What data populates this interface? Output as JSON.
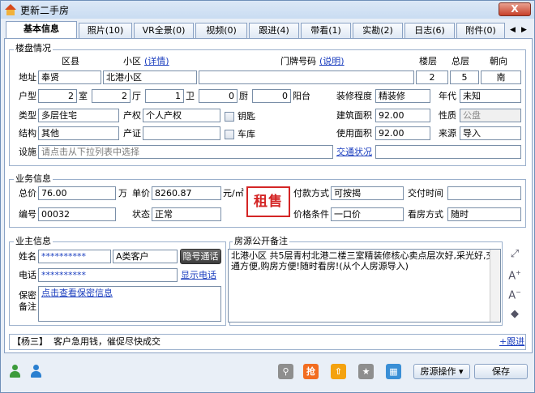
{
  "window": {
    "title": "更新二手房",
    "close_glyph": "X"
  },
  "tabs": [
    {
      "label": "基本信息"
    },
    {
      "label": "照片(10)"
    },
    {
      "label": "VR全景(0)"
    },
    {
      "label": "视频(0)"
    },
    {
      "label": "跟进(4)"
    },
    {
      "label": "带看(1)"
    },
    {
      "label": "实勘(2)"
    },
    {
      "label": "日志(6)"
    },
    {
      "label": "附件(0)"
    }
  ],
  "tab_nav": {
    "prev": "◀",
    "next": "▶"
  },
  "property": {
    "section_title": "楼盘情况",
    "hdr_district": "区县",
    "hdr_community": "小区",
    "hdr_community_link": "(详情)",
    "hdr_door": "门牌号码",
    "hdr_door_link": "(说明)",
    "hdr_floor": "楼层",
    "hdr_total_floor": "总层",
    "hdr_orientation": "朝向",
    "address_label": "地址",
    "district": "奉贤",
    "community": "北港小区",
    "door_no": "",
    "floor": "2",
    "total_floor": "5",
    "orientation": "南",
    "layout_label": "户型",
    "rooms": "2",
    "room_unit": "室",
    "halls": "2",
    "hall_unit": "厅",
    "baths": "1",
    "bath_unit": "卫",
    "kitchens": "0",
    "kitchen_unit": "厨",
    "balconies": "0",
    "balcony_unit": "阳台",
    "decoration_label": "装修程度",
    "decoration": "精装修",
    "year_label": "年代",
    "year": "未知",
    "type_label": "类型",
    "type": "多层住宅",
    "ownership_label": "产权",
    "ownership": "个人产权",
    "has_key_label": "钥匙",
    "building_area_label": "建筑面积",
    "building_area": "92.00",
    "nature_label": "性质",
    "nature": "公盘",
    "structure_label": "结构",
    "structure": "其他",
    "certificate_label": "产证",
    "certificate": "",
    "garage_label": "车库",
    "usable_area_label": "使用面积",
    "usable_area": "92.00",
    "source_label": "来源",
    "source": "导入",
    "facilities_label": "设施",
    "facilities_placeholder": "请点击从下拉列表中选择",
    "traffic_link": "交通状况",
    "traffic": ""
  },
  "business": {
    "section_title": "业务信息",
    "total_price_label": "总价",
    "total_price": "76.00",
    "total_price_unit": "万",
    "unit_price_label": "单价",
    "unit_price": "8260.87",
    "unit_price_unit": "元/㎡",
    "stamp": "租售",
    "payment_label": "付款方式",
    "payment": "可按揭",
    "handover_label": "交付时间",
    "handover": "",
    "code_label": "编号",
    "code": "00032",
    "status_label": "状态",
    "status": "正常",
    "price_terms_label": "价格条件",
    "price_terms": "一口价",
    "viewing_label": "看房方式",
    "viewing": "随时"
  },
  "owner": {
    "section_title": "业主信息",
    "name_label": "姓名",
    "name": "**********",
    "category": "A类客户",
    "hidden_call_btn": "隐号通话",
    "phone_label": "电话",
    "phone": "**********",
    "show_phone_link": "显示电话",
    "secret_label_1": "保密",
    "secret_label_2": "备注",
    "secret_link": "点击查看保密信息"
  },
  "remarks": {
    "section_title": "房源公开备注",
    "text": "北港小区 共5层青村北港二楼三室精装修核心卖点层次好,采光好,交通方便,购房方便!随时看房!(从个人房源导入)"
  },
  "followup": {
    "agent": "【杨三】",
    "text": "客户急用钱，催促尽快成交",
    "add_link": "+跟进"
  },
  "toolbar": {
    "grab_label": "抢",
    "ops_button": "房源操作",
    "ops_arrow": "▾",
    "save_button": "保存"
  },
  "colors": {
    "accent": "#1c3fbf",
    "stamp": "#d42525",
    "grab": "#f26d21",
    "top": "#f4a20f",
    "grey_tool": "#8e8e8e",
    "calc": "#3a8fd6",
    "user_green": "#3c9b3c",
    "user_blue": "#2a7fd0"
  }
}
